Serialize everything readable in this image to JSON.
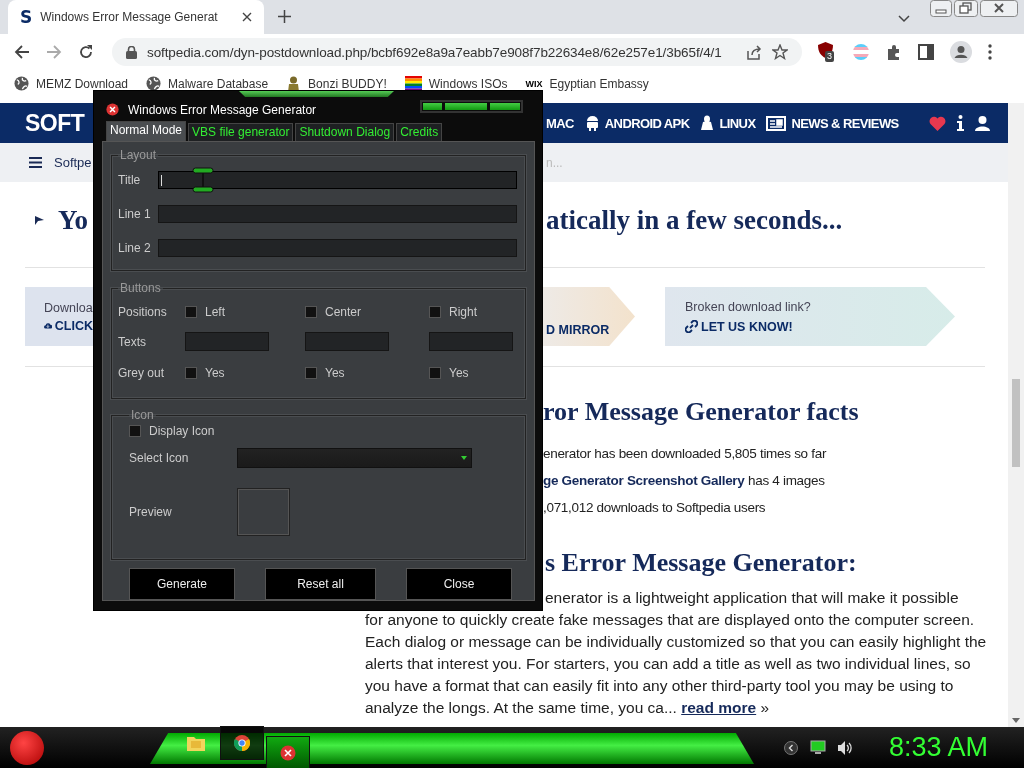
{
  "browser": {
    "tab": {
      "favicon": "S",
      "title": "Windows Error Message Generat"
    },
    "url": "softpedia.com/dyn-postdownload.php/bcbf692e8a9a7eabb7e908f7b22634e8/62e257e1/3b65f/4/1",
    "extension_badge": "3",
    "bookmarks": [
      {
        "label": "MEMZ Download",
        "kind": "globe"
      },
      {
        "label": "Malware Database",
        "kind": "globe"
      },
      {
        "label": "Bonzi BUDDY!",
        "kind": "figure"
      },
      {
        "label": "Windows ISOs",
        "kind": "flag"
      },
      {
        "label": "Egyptian Embassy",
        "kind": "text",
        "icon_text": "WIX"
      }
    ]
  },
  "site": {
    "logo": "SOFT",
    "nav": [
      {
        "label": "MAC",
        "kind": "none"
      },
      {
        "label": "ANDROID APK",
        "kind": "android"
      },
      {
        "label": "LINUX",
        "kind": "linux"
      },
      {
        "label": "NEWS & REVIEWS",
        "kind": "news"
      }
    ],
    "breadcrumb": "Softpe",
    "breadcrumb_tail": "n...",
    "headline_start": "Yo",
    "headline_end": "atically in a few seconds...",
    "download_card": {
      "title": "Downloa",
      "link": "CLICK"
    },
    "mirror_card": {
      "link": "D MIRROR"
    },
    "report_card": {
      "title": "Broken download link?",
      "link": "LET US KNOW!"
    },
    "facts_title": "ror Message Generator facts",
    "facts": [
      {
        "text": "enerator has been downloaded 5,805 times so far"
      },
      {
        "link": "ge Generator Screenshot Gallery",
        "text": " has 4 images"
      },
      {
        "text": ",071,012 downloads to Softpedia users"
      }
    ],
    "about_title": "s Error Message Generator:",
    "about_first_line": "enerator is a lightweight application that will make it possible",
    "about_text": "for anyone to quickly create fake messages that are displayed onto the computer screen. Each dialog or message can be individually customized so that you can easily highlight the alerts that interest you. For starters, you can add a title as well as two individual lines, so you have a format that can easily fit into any other third-party tool you may be using to analyze the longs. At the same time, you ca...",
    "read_more": "read more",
    "read_more_tail": " »"
  },
  "app": {
    "title": "Windows Error Message Generator",
    "tabs": [
      {
        "label": "Normal Mode",
        "selected": true
      },
      {
        "label": "VBS file generator",
        "selected": false
      },
      {
        "label": "Shutdown Dialog",
        "selected": false
      },
      {
        "label": "Credits",
        "selected": false
      }
    ],
    "layout": {
      "legend": "Layout",
      "fields": [
        {
          "label": "Title",
          "focused": true
        },
        {
          "label": "Line 1",
          "focused": false
        },
        {
          "label": "Line 2",
          "focused": false
        }
      ]
    },
    "buttons_group": {
      "legend": "Buttons",
      "positions_label": "Positions",
      "texts_label": "Texts",
      "grey_label": "Grey out",
      "columns": [
        {
          "position": "Left",
          "position_checked": false,
          "grey": "Yes",
          "grey_checked": false
        },
        {
          "position": "Center",
          "position_checked": false,
          "grey": "Yes",
          "grey_checked": false
        },
        {
          "position": "Right",
          "position_checked": false,
          "grey": "Yes",
          "grey_checked": false
        }
      ]
    },
    "icon_group": {
      "legend": "Icon",
      "display": {
        "label": "Display Icon",
        "checked": false
      },
      "select_label": "Select Icon",
      "preview_label": "Preview"
    },
    "actions": [
      "Generate",
      "Reset all",
      "Close"
    ]
  },
  "taskbar": {
    "apps": [
      {
        "kind": "folder",
        "selected": false
      },
      {
        "kind": "chrome",
        "selected": false
      },
      {
        "kind": "error",
        "selected": true
      }
    ],
    "clock": "8:33 AM"
  }
}
